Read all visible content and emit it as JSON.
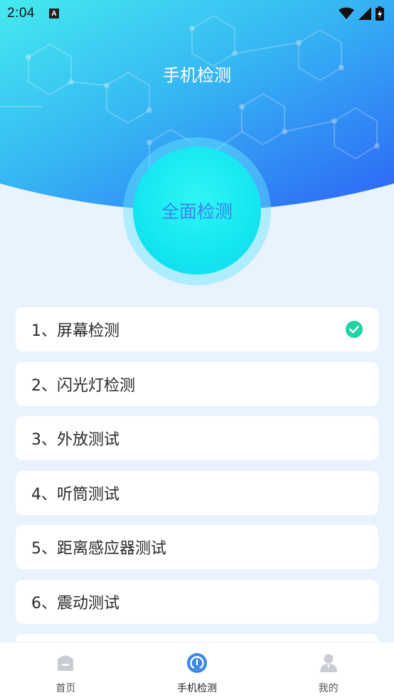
{
  "status_bar": {
    "time": "2:04",
    "notification_badge": "A"
  },
  "header": {
    "title": "手机检测"
  },
  "main_button": {
    "label": "全面检测"
  },
  "checks": [
    {
      "label": "1、屏幕检测",
      "done": true
    },
    {
      "label": "2、闪光灯检测",
      "done": false
    },
    {
      "label": "3、外放测试",
      "done": false
    },
    {
      "label": "4、听筒测试",
      "done": false
    },
    {
      "label": "5、距离感应器测试",
      "done": false
    },
    {
      "label": "6、震动测试",
      "done": false
    },
    {
      "label": "",
      "done": false
    }
  ],
  "tabs": [
    {
      "label": "首页",
      "icon": "home-icon",
      "active": false
    },
    {
      "label": "手机检测",
      "icon": "gauge-icon",
      "active": true
    },
    {
      "label": "我的",
      "icon": "user-icon",
      "active": false
    }
  ],
  "colors": {
    "accent": "#3a86e8",
    "check_green": "#1ed3a5",
    "header_start": "#3ee6f0",
    "header_end": "#2e6cf5"
  }
}
